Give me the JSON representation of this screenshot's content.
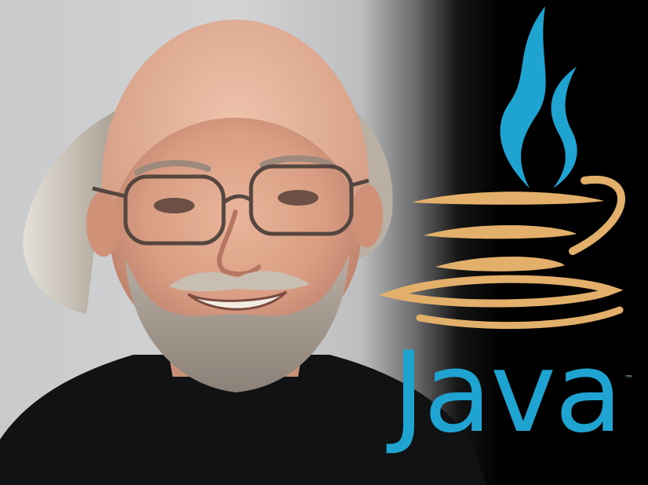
{
  "logo": {
    "wordmark": "Java",
    "trademark": "™",
    "colors": {
      "steam": "#1fa4d2",
      "cup": "#e2b06a",
      "wordmark": "#1fa4d2"
    }
  },
  "photo": {
    "subject": "portrait-photo",
    "background": "#cfd0d2"
  }
}
